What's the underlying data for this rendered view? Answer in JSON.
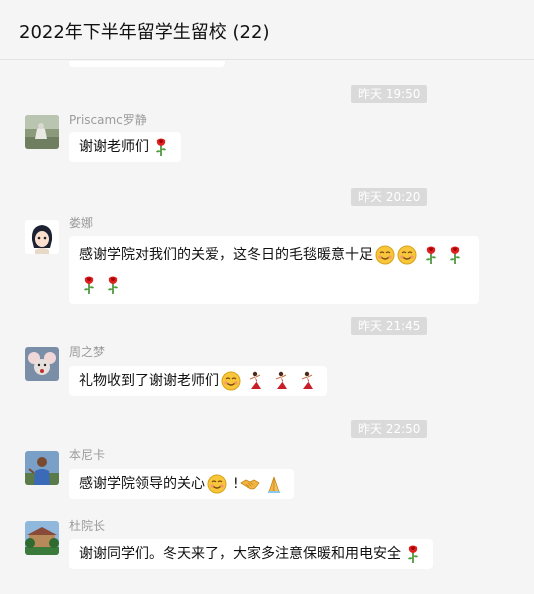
{
  "header": {
    "title": "2022年下半年留学生留校 (22)"
  },
  "messages": [
    {
      "timestamp": "昨天 19:50",
      "sender": "Priscamc罗静",
      "avatar_icon": "landscape-photo-avatar",
      "lines": [
        {
          "text": "谢谢老师们",
          "emojis": [
            "rose-emoji"
          ]
        }
      ]
    },
    {
      "timestamp": "昨天 20:20",
      "sender": "娄娜",
      "avatar_icon": "cartoon-girl-avatar",
      "lines": [
        {
          "text": "感谢学院对我们的关爱，这冬日的毛毯暖意十足",
          "emojis": [
            "blush-emoji",
            "blush-emoji",
            "rose-emoji",
            "rose-emoji"
          ]
        },
        {
          "text": "",
          "emojis": [
            "rose-emoji",
            "rose-emoji"
          ]
        }
      ]
    },
    {
      "timestamp": "昨天 21:45",
      "sender": "周之梦",
      "avatar_icon": "cartoon-mouse-avatar",
      "lines": [
        {
          "text": "礼物收到了谢谢老师们",
          "emojis": [
            "smile-emoji",
            "dancer-emoji",
            "dancer-emoji",
            "dancer-emoji"
          ]
        }
      ]
    },
    {
      "timestamp": "昨天 22:50",
      "sender": "本尼卡",
      "avatar_icon": "person-photo-avatar",
      "lines": [
        {
          "text": "感谢学院领导的关心",
          "emojis": [
            "smile-emoji"
          ],
          "suffix": "!",
          "emojis_after": [
            "handshake-emoji",
            "folded-hands-emoji"
          ]
        }
      ]
    },
    {
      "timestamp": "",
      "sender": "杜院长",
      "avatar_icon": "building-photo-avatar",
      "lines": [
        {
          "text": "谢谢同学们。冬天来了，大家多注意保暖和用电安全",
          "emojis": [
            "rose-emoji"
          ]
        }
      ]
    }
  ],
  "colors": {
    "background": "#f5f5f5",
    "bubble": "#ffffff",
    "timestamp_bg": "#dadada",
    "sender_text": "#9b9b9b"
  }
}
